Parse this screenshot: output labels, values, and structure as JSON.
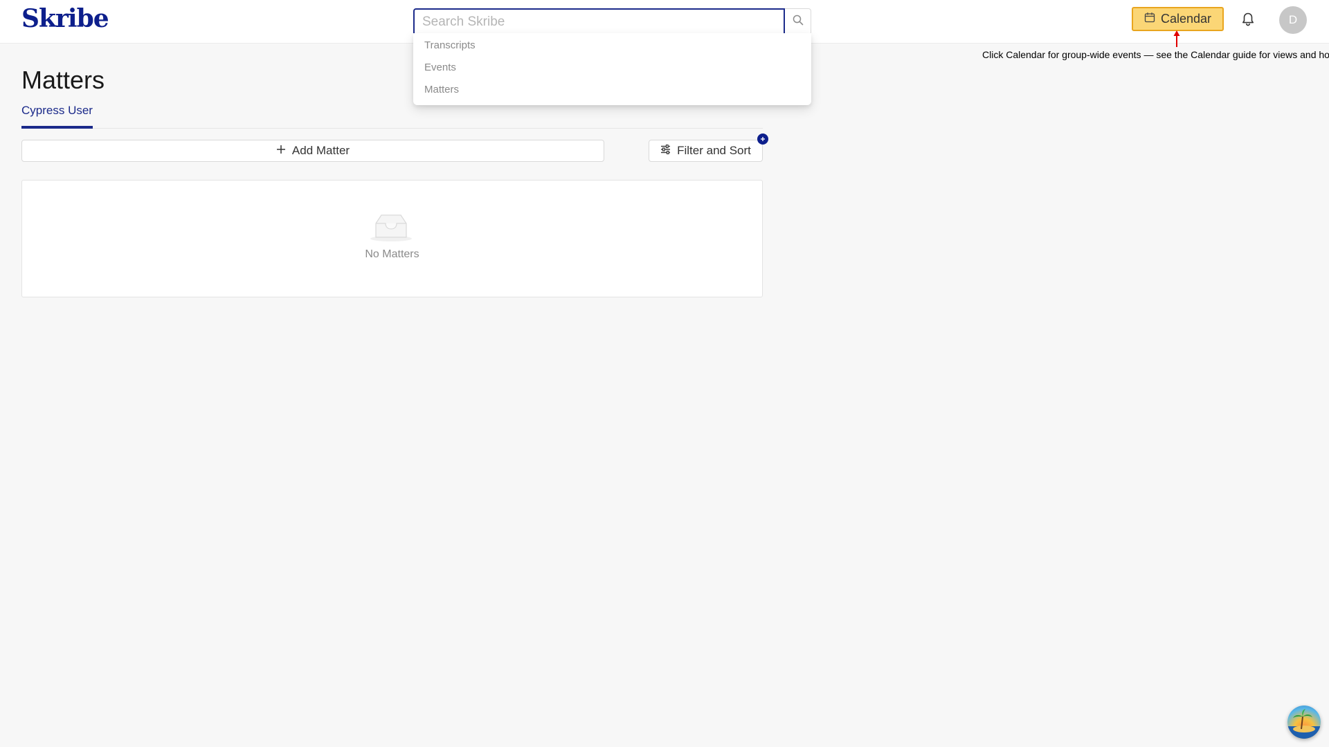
{
  "app": {
    "logo_text": "Skribe"
  },
  "search": {
    "placeholder": "Search Skribe",
    "value": "",
    "suggestions": [
      "Transcripts",
      "Events",
      "Matters"
    ]
  },
  "header": {
    "calendar_label": "Calendar",
    "hint_text": "Click Calendar for group-wide events — see the Calendar guide for views and ho",
    "avatar_initial": "D"
  },
  "page": {
    "title": "Matters",
    "tabs": [
      {
        "label": "Cypress User",
        "active": true
      }
    ],
    "add_button_label": "Add Matter",
    "filter_button_label": "Filter and Sort",
    "empty_text": "No Matters"
  },
  "colors": {
    "brand": "#0d1f8c",
    "calendar_highlight": "#fbd676",
    "calendar_border": "#e9a51e",
    "hint_arrow": "#e00000"
  },
  "icons": {
    "search": "search-icon",
    "calendar": "calendar-icon",
    "bell": "bell-icon",
    "plus": "plus-icon",
    "filter": "sliders-icon",
    "empty": "inbox-icon",
    "widget": "beach-widget-icon"
  }
}
